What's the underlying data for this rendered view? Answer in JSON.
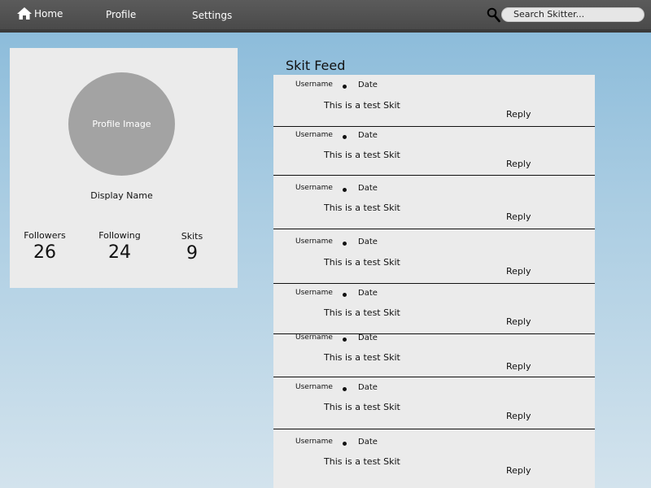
{
  "nav": {
    "home_label": "Home",
    "profile_label": "Profile",
    "settings_label": "Settings",
    "search_placeholder": "Search Skitter..."
  },
  "profile": {
    "image_label": "Profile Image",
    "display_name": "Display Name",
    "followers_label": "Followers",
    "followers_value": "26",
    "following_label": "Following",
    "following_value": "24",
    "skits_label": "Skits",
    "skits_value": "9"
  },
  "feed": {
    "title": "Skit Feed",
    "items": [
      {
        "username": "Username",
        "date": "Date",
        "text": "This is a test Skit",
        "reply": "Reply"
      },
      {
        "username": "Username",
        "date": "Date",
        "text": "This is a test Skit",
        "reply": "Reply"
      },
      {
        "username": "Username",
        "date": "Date",
        "text": "This is a test Skit",
        "reply": "Reply"
      },
      {
        "username": "Username",
        "date": "Date",
        "text": "This is a test Skit",
        "reply": "Reply"
      },
      {
        "username": "Username",
        "date": "Date",
        "text": "This is a test Skit",
        "reply": "Reply"
      },
      {
        "username": "Username",
        "date": "Date",
        "text": "This is a test Skit",
        "reply": "Reply"
      },
      {
        "username": "Username",
        "date": "Date",
        "text": "This is a test Skit",
        "reply": "Reply"
      },
      {
        "username": "Username",
        "date": "Date",
        "text": "This is a test Skit",
        "reply": "Reply"
      }
    ]
  },
  "colors": {
    "topbar": "#4f4f4f",
    "card_background": "#ebebeb",
    "profile_image": "#a3a3a3",
    "background_top": "#87b9d9",
    "background_bottom": "#d3e3ed"
  }
}
